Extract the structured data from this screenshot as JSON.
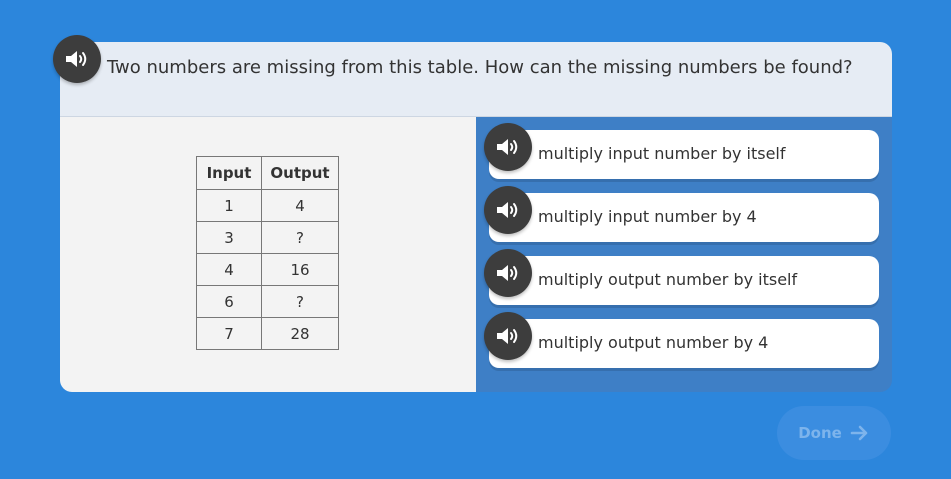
{
  "question": {
    "text": "Two numbers are missing from this table. How can the missing numbers be found?"
  },
  "table": {
    "headers": [
      "Input",
      "Output"
    ],
    "rows": [
      [
        "1",
        "4"
      ],
      [
        "3",
        "?"
      ],
      [
        "4",
        "16"
      ],
      [
        "6",
        "?"
      ],
      [
        "7",
        "28"
      ]
    ]
  },
  "answers": [
    {
      "label": "multiply input number by itself"
    },
    {
      "label": "multiply input number by 4"
    },
    {
      "label": "multiply output number by itself"
    },
    {
      "label": "multiply output number by 4"
    }
  ],
  "done": {
    "label": "Done",
    "icon": "arrow-right-icon"
  },
  "icons": {
    "audio": "speaker-icon"
  },
  "colors": {
    "background": "#2c86dc",
    "question_bar": "#e6ecf4",
    "left_pane": "#f3f3f3",
    "right_pane": "#3e7fc6",
    "audio_button": "#3d3d3d",
    "done_button": "#3b8de0",
    "done_text": "#7db4ec"
  }
}
